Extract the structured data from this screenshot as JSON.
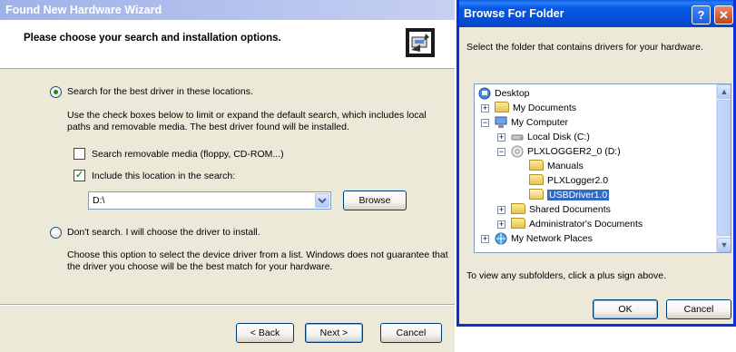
{
  "wizard": {
    "title": "Found New Hardware Wizard",
    "header_title": "Please choose your search and installation options.",
    "icon_name": "hardware-wizard-icon",
    "option_search": "Search for the best driver in these locations.",
    "search_desc": "Use the check boxes below to limit or expand the default search, which includes local paths and removable media. The best driver found will be installed.",
    "check_removable": {
      "label": "Search removable media (floppy, CD-ROM...)",
      "checked": false
    },
    "check_include": {
      "label": "Include this location in the search:",
      "checked": true
    },
    "location_value": "D:\\",
    "browse_label": "Browse",
    "option_dont_search": "Don't search. I will choose the driver to install.",
    "dont_search_desc": "Choose this option to select the device driver from a list.  Windows does not guarantee that the driver you choose will be the best match for your hardware.",
    "back_label": "< Back",
    "next_label": "Next >",
    "cancel_label": "Cancel"
  },
  "browse": {
    "title": "Browse For Folder",
    "help_glyph": "?",
    "close_glyph": "✕",
    "instruction": "Select the folder that contains drivers for your hardware.",
    "tree": [
      {
        "label": "Desktop",
        "icon": "desktop-icon",
        "toggle": ""
      },
      {
        "label": "My Documents",
        "icon": "folder-icon",
        "toggle": "+"
      },
      {
        "label": "My Computer",
        "icon": "computer-icon",
        "toggle": "−"
      },
      {
        "label": "Local Disk (C:)",
        "icon": "disk-icon",
        "toggle": "+"
      },
      {
        "label": "PLXLOGGER2_0 (D:)",
        "icon": "cd-icon",
        "toggle": "−"
      },
      {
        "label": "Manuals",
        "icon": "folder-icon",
        "toggle": ""
      },
      {
        "label": "PLXLogger2.0",
        "icon": "folder-icon",
        "toggle": ""
      },
      {
        "label": "USBDriver1.0",
        "icon": "folder-open-icon",
        "toggle": "",
        "selected": true
      },
      {
        "label": "Shared Documents",
        "icon": "folder-icon",
        "toggle": "+"
      },
      {
        "label": "Administrator's Documents",
        "icon": "folder-icon",
        "toggle": "+"
      },
      {
        "label": "My Network Places",
        "icon": "network-icon",
        "toggle": "+"
      }
    ],
    "hint": "To view any subfolders, click a plus sign above.",
    "ok_label": "OK",
    "cancel_label": "Cancel"
  }
}
